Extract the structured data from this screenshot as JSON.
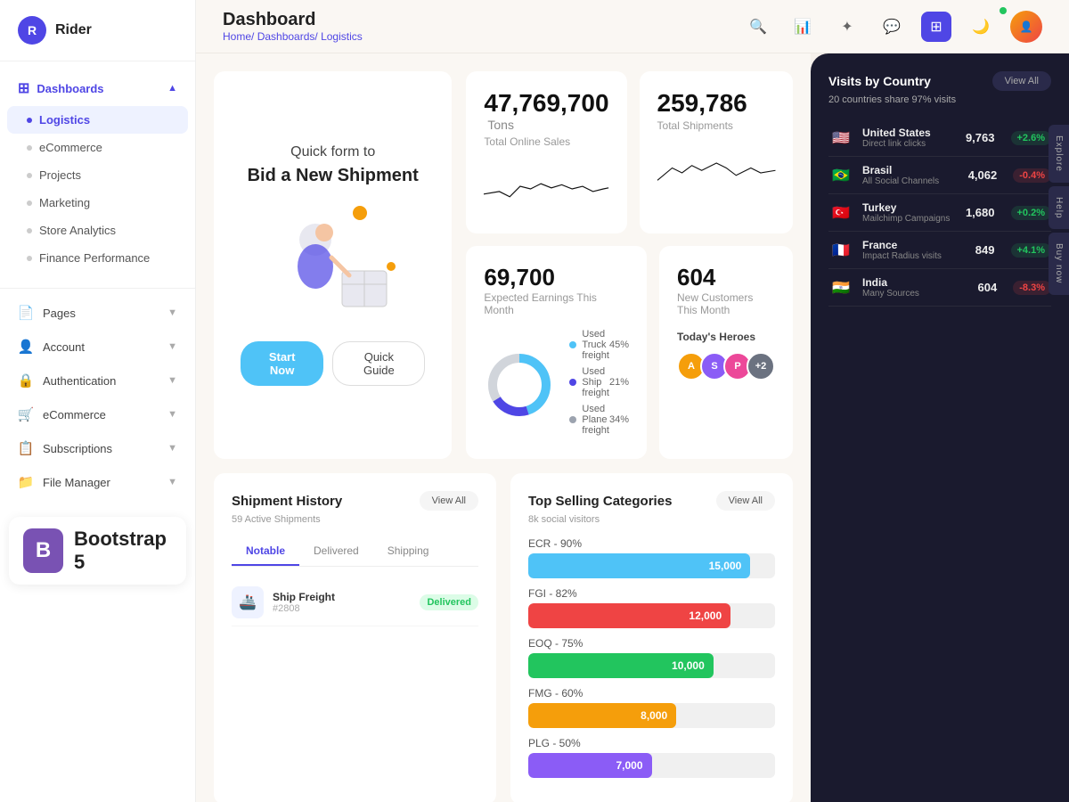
{
  "app": {
    "name": "Rider",
    "logo_letter": "R"
  },
  "header": {
    "title": "Dashboard",
    "breadcrumb": [
      "Home",
      "Dashboards",
      "Logistics"
    ]
  },
  "sidebar": {
    "dashboards_label": "Dashboards",
    "items": [
      {
        "label": "Logistics",
        "active": true
      },
      {
        "label": "eCommerce",
        "active": false
      },
      {
        "label": "Projects",
        "active": false
      },
      {
        "label": "Marketing",
        "active": false
      },
      {
        "label": "Store Analytics",
        "active": false
      },
      {
        "label": "Finance Performance",
        "active": false
      }
    ],
    "main_items": [
      {
        "label": "Pages",
        "icon": "📄"
      },
      {
        "label": "Account",
        "icon": "👤"
      },
      {
        "label": "Authentication",
        "icon": "🔒"
      },
      {
        "label": "eCommerce",
        "icon": "🛒"
      },
      {
        "label": "Subscriptions",
        "icon": "📋"
      },
      {
        "label": "File Manager",
        "icon": "📁"
      }
    ]
  },
  "stats": {
    "total_online_sales": "47,769,700",
    "total_online_sales_unit": "Tons",
    "total_online_sales_label": "Total Online Sales",
    "total_shipments": "259,786",
    "total_shipments_label": "Total Shipments",
    "expected_earnings": "69,700",
    "expected_earnings_label": "Expected Earnings This Month",
    "new_customers": "604",
    "new_customers_label": "New Customers This Month"
  },
  "promo": {
    "line1": "Quick form to",
    "line2": "Bid a New Shipment",
    "btn_primary": "Start Now",
    "btn_secondary": "Quick Guide"
  },
  "freight": {
    "truck": {
      "label": "Used Truck freight",
      "pct": "45%",
      "value": 45,
      "color": "#4FC3F7"
    },
    "ship": {
      "label": "Used Ship freight",
      "pct": "21%",
      "value": 21,
      "color": "#4F46E5"
    },
    "plane": {
      "label": "Used Plane freight",
      "pct": "34%",
      "value": 34,
      "color": "#E5E7EB"
    }
  },
  "heroes": {
    "label": "Today's Heroes",
    "avatars": [
      {
        "bg": "#F59E0B",
        "letter": "A"
      },
      {
        "bg": "#8B5CF6",
        "letter": "S"
      },
      {
        "bg": "#EC4899",
        "letter": "P"
      },
      {
        "bg": "#6B7280",
        "letter": "+"
      }
    ]
  },
  "shipment_history": {
    "title": "Shipment History",
    "subtitle": "59 Active Shipments",
    "view_all": "View All",
    "tabs": [
      "Notable",
      "Delivered",
      "Shipping"
    ],
    "active_tab": 0,
    "items": [
      {
        "name": "Ship Freight",
        "id": "#2808",
        "status": "Delivered",
        "status_class": "delivered"
      }
    ]
  },
  "categories": {
    "title": "Top Selling Categories",
    "subtitle": "8k social visitors",
    "view_all": "View All",
    "bars": [
      {
        "label": "ECR - 90%",
        "value": 15000,
        "display": "15,000",
        "color": "#4FC3F7",
        "width": "90%"
      },
      {
        "label": "FGI - 82%",
        "value": 12000,
        "display": "12,000",
        "color": "#EF4444",
        "width": "82%"
      },
      {
        "label": "EOQ - 75%",
        "value": 10000,
        "display": "10,000",
        "color": "#22C55E",
        "width": "75%"
      },
      {
        "label": "FMG - 60%",
        "value": 8000,
        "display": "8,000",
        "color": "#F59E0B",
        "width": "60%"
      },
      {
        "label": "PLG - 50%",
        "value": 7000,
        "display": "7,000",
        "color": "#8B5CF6",
        "width": "50%"
      }
    ]
  },
  "visits": {
    "title": "Visits by Country",
    "subtitle": "20 countries share 97% visits",
    "view_all": "View All",
    "countries": [
      {
        "flag": "🇺🇸",
        "name": "United States",
        "source": "Direct link clicks",
        "value": "9,763",
        "change": "+2.6%",
        "up": true
      },
      {
        "flag": "🇧🇷",
        "name": "Brasil",
        "source": "All Social Channels",
        "value": "4,062",
        "change": "-0.4%",
        "up": false
      },
      {
        "flag": "🇹🇷",
        "name": "Turkey",
        "source": "Mailchimp Campaigns",
        "value": "1,680",
        "change": "+0.2%",
        "up": true
      },
      {
        "flag": "🇫🇷",
        "name": "France",
        "source": "Impact Radius visits",
        "value": "849",
        "change": "+4.1%",
        "up": true
      },
      {
        "flag": "🇮🇳",
        "name": "India",
        "source": "Many Sources",
        "value": "604",
        "change": "-8.3%",
        "up": false
      }
    ]
  },
  "bootstrap": {
    "icon": "B",
    "text": "Bootstrap 5"
  },
  "side_tabs": [
    "Explore",
    "Help",
    "Buy now"
  ]
}
